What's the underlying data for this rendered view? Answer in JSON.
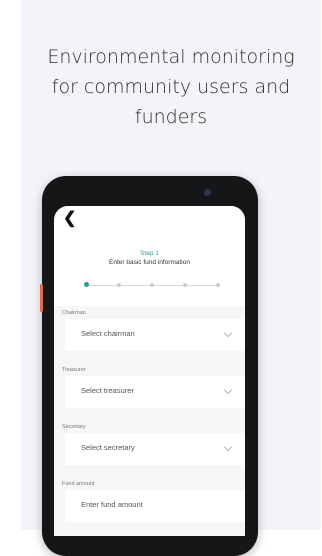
{
  "headline": [
    "Environmental monitoring",
    "for community users and",
    "funders"
  ],
  "form": {
    "back_glyph": "❮",
    "step_label": "Step 1",
    "step_title": "Enter basic fund information",
    "stepper": {
      "total_steps": 5,
      "current_step": 1
    },
    "fields": [
      {
        "label": "Chairman",
        "placeholder": "Select chairman",
        "type": "select"
      },
      {
        "label": "Treasurer",
        "placeholder": "Select treasurer",
        "type": "select"
      },
      {
        "label": "Secretary",
        "placeholder": "Select secretary",
        "type": "select"
      },
      {
        "label": "Fund amount",
        "placeholder": "Enter fund amount",
        "type": "input"
      }
    ]
  },
  "colors": {
    "accent": "#2e9a8c",
    "background": "#f3f4f7"
  }
}
